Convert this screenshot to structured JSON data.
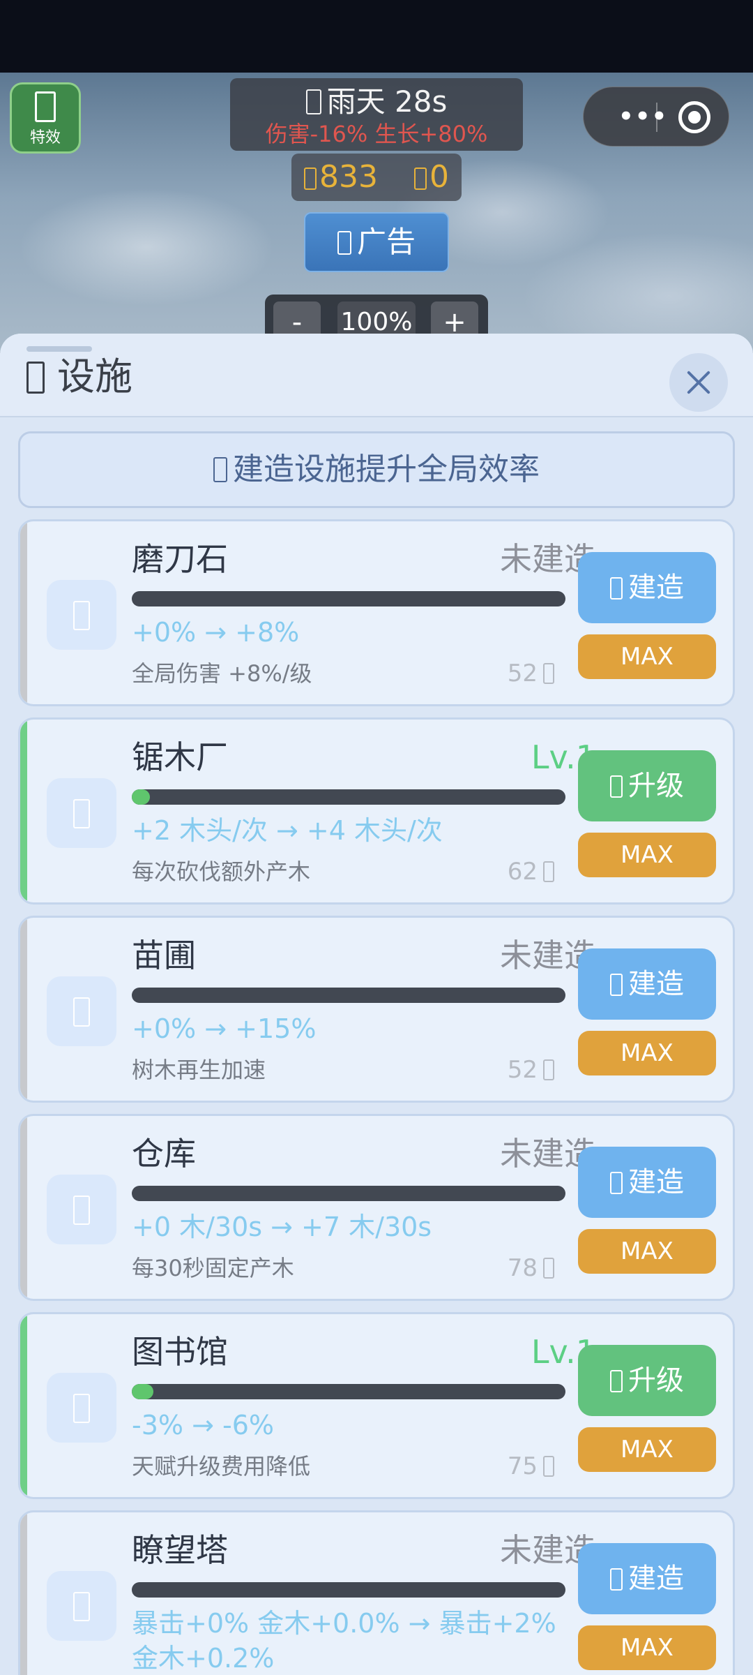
{
  "hud": {
    "effects_label": "特效",
    "weather_text": "雨天 28s",
    "weather_modifiers": "伤害-16% 生长+80%",
    "wood_count": "833",
    "gem_count": "0",
    "ad_label": "广告",
    "zoom_minus": "-",
    "zoom_value": "100%",
    "zoom_plus": "+",
    "menu_dots": "•••"
  },
  "panel": {
    "title": "设施",
    "banner": "建造设施提升全局效率"
  },
  "facilities": [
    {
      "name": "磨刀石",
      "status": "未建造",
      "progress": 0,
      "effect": "+0% → +8%",
      "desc": "全局伤害 +8%/级",
      "cost": "52",
      "action": "建造",
      "max": "MAX",
      "built": false
    },
    {
      "name": "锯木厂",
      "status": "Lv.1",
      "progress": 0.04,
      "effect": "+2 木头/次 → +4 木头/次",
      "desc": "每次砍伐额外产木",
      "cost": "62",
      "action": "升级",
      "max": "MAX",
      "built": true
    },
    {
      "name": "苗圃",
      "status": "未建造",
      "progress": 0,
      "effect": "+0% → +15%",
      "desc": "树木再生加速",
      "cost": "52",
      "action": "建造",
      "max": "MAX",
      "built": false
    },
    {
      "name": "仓库",
      "status": "未建造",
      "progress": 0,
      "effect": "+0 木/30s → +7 木/30s",
      "desc": "每30秒固定产木",
      "cost": "78",
      "action": "建造",
      "max": "MAX",
      "built": false
    },
    {
      "name": "图书馆",
      "status": "Lv.1",
      "progress": 0.05,
      "effect": "-3% → -6%",
      "desc": "天赋升级费用降低",
      "cost": "75",
      "action": "升级",
      "max": "MAX",
      "built": true
    },
    {
      "name": "瞭望塔",
      "status": "未建造",
      "progress": 0,
      "effect": "暴击+0% 金木+0.0% → 暴击+2% 金木+0.2%",
      "desc": "",
      "cost": "",
      "action": "建造",
      "max": "MAX",
      "built": false
    }
  ],
  "colors": {
    "accent_built": "#6fcf87",
    "build_button": "#6fb3ee",
    "upgrade_button": "#62c27e",
    "max_button": "#e0a23c",
    "weather_modifier": "#e0564f",
    "currency": "#e8b33a"
  }
}
